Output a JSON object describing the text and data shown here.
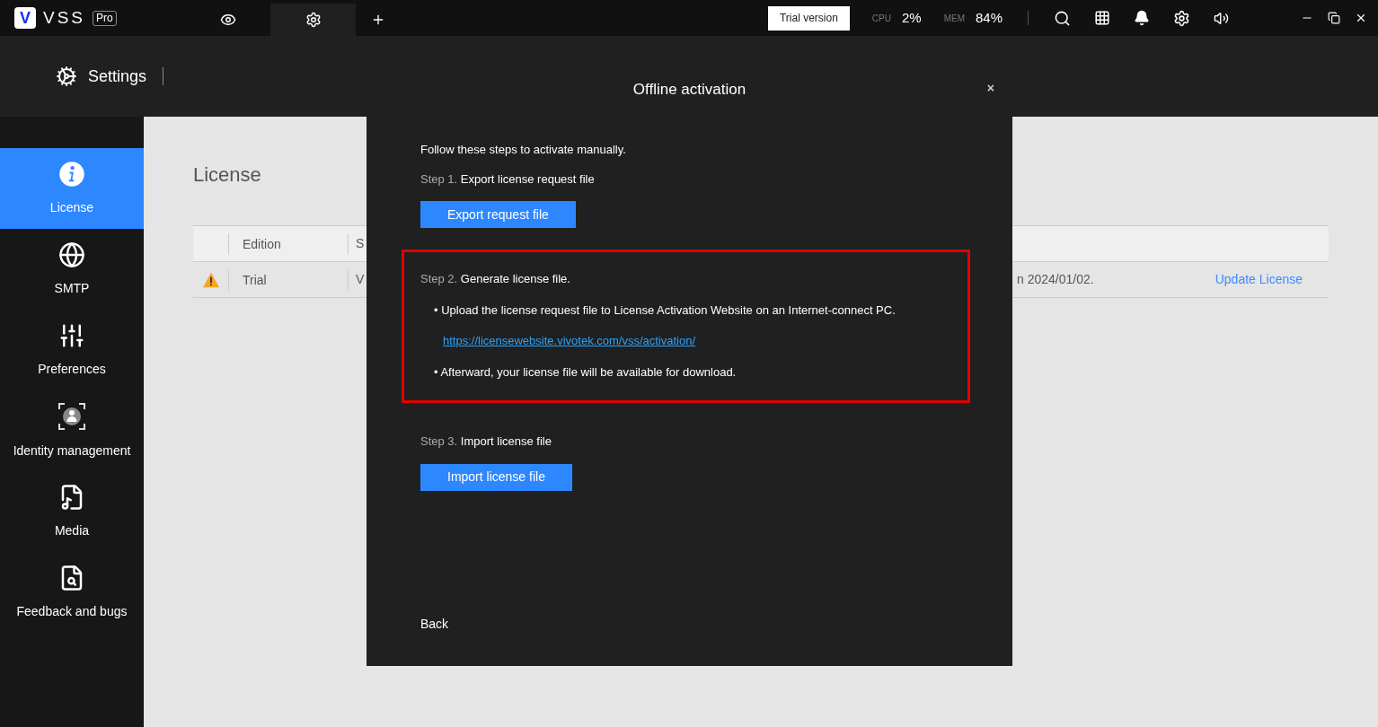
{
  "app": {
    "logo_letter": "V",
    "name": "VSS",
    "edition": "Pro"
  },
  "tabs": [
    {
      "kind": "live",
      "selected": false
    },
    {
      "kind": "settings",
      "selected": true
    },
    {
      "kind": "add",
      "selected": false
    }
  ],
  "trial_badge": "Trial version",
  "stats": [
    {
      "label": "CPU",
      "value": "2%"
    },
    {
      "label": "MEM",
      "value": "84%"
    }
  ],
  "page_title": "Settings",
  "sidebar": {
    "items": [
      {
        "kind": "info",
        "label": "License",
        "selected": true
      },
      {
        "kind": "globe",
        "label": "SMTP",
        "selected": false
      },
      {
        "kind": "sliders",
        "label": "Preferences",
        "selected": false
      },
      {
        "kind": "identity",
        "label": "Identity management",
        "selected": false
      },
      {
        "kind": "media",
        "label": "Media",
        "selected": false
      },
      {
        "kind": "feedback",
        "label": "Feedback and bugs",
        "selected": false
      }
    ]
  },
  "content": {
    "title": "License",
    "table": {
      "columns": [
        "Edition",
        "S"
      ],
      "rows": [
        {
          "kind": "warning",
          "cells": [
            "Trial",
            "V",
            "n 2024/01/02."
          ],
          "action": "Update License"
        }
      ]
    }
  },
  "dialog": {
    "title": "Offline activation",
    "close": "×",
    "intro": "Follow these steps to activate manually.",
    "steps": [
      {
        "number": "Step 1.",
        "title": "Export license request file",
        "highlighted": false,
        "button": "Export request file"
      },
      {
        "number": "Step 2.",
        "title": "Generate license file.",
        "highlighted": true,
        "items": [
          {
            "kind": "bullet",
            "text": "• Upload the license request file to License Activation Website on an Internet-connect PC."
          },
          {
            "kind": "link",
            "text": "https://licensewebsite.vivotek.com/vss/activation/"
          },
          {
            "kind": "bullet",
            "text": "• Afterward, your license file will be available for download."
          }
        ]
      },
      {
        "number": "Step 3.",
        "title": "Import license file",
        "highlighted": false,
        "button": "Import license file"
      }
    ],
    "back": "Back"
  }
}
